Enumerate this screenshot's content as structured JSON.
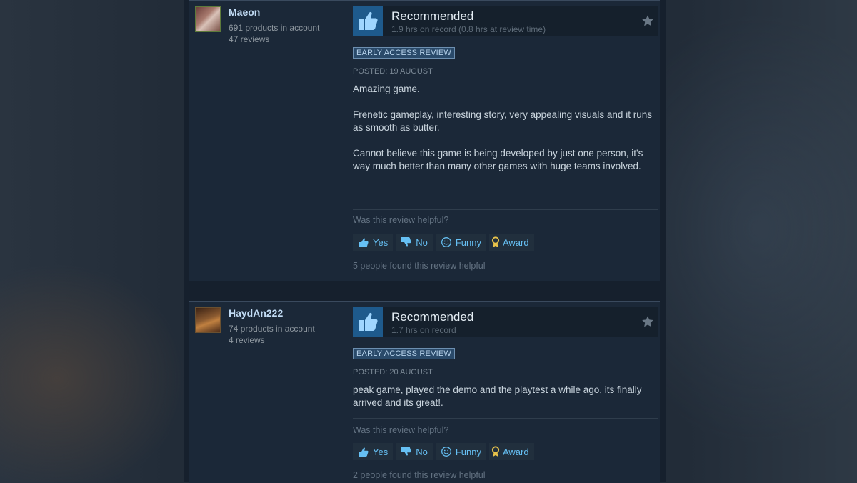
{
  "reviews": [
    {
      "author": {
        "name": "Maeon",
        "products": "691 products in account",
        "reviews": "47 reviews"
      },
      "recommendation": "Recommended",
      "hours": "1.9 hrs on record (0.8 hrs at review time)",
      "badge": "EARLY ACCESS REVIEW",
      "posted": "POSTED: 19 AUGUST",
      "paragraphs": [
        "Amazing game.",
        "Frenetic gameplay, interesting story, very appealing visuals and it runs as smooth as butter.",
        "Cannot believe this game is being developed by just one person, it's way much better than many other games with huge teams involved."
      ],
      "helpful_question": "Was this review helpful?",
      "buttons": {
        "yes": "Yes",
        "no": "No",
        "funny": "Funny",
        "award": "Award"
      },
      "found_helpful": "5 people found this review helpful"
    },
    {
      "author": {
        "name": "HaydAn222",
        "products": "74 products in account",
        "reviews": "4 reviews"
      },
      "recommendation": "Recommended",
      "hours": "1.7 hrs on record",
      "badge": "EARLY ACCESS REVIEW",
      "posted": "POSTED: 20 AUGUST",
      "paragraphs": [
        "peak game, played the demo and the playtest a while ago, its finally arrived and its great!."
      ],
      "helpful_question": "Was this review helpful?",
      "buttons": {
        "yes": "Yes",
        "no": "No",
        "funny": "Funny",
        "award": "Award"
      },
      "found_helpful": "2 people found this review helpful"
    }
  ],
  "colors": {
    "page_bg": "#1b2838",
    "link_blue": "#66c0f4",
    "thumb_bg": "#1e5a8c",
    "author_name": "#c1dbf4"
  }
}
